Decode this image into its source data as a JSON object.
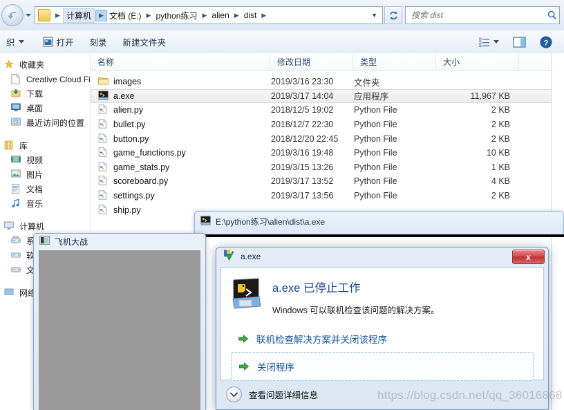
{
  "explorer": {
    "breadcrumb": {
      "root_label": "计算机",
      "items": [
        "文档 (E:)",
        "python练习",
        "alien",
        "dist"
      ]
    },
    "search": {
      "placeholder": "搜索 dist",
      "value": ""
    },
    "toolbar": {
      "organize_label": "织",
      "open_label": "打开",
      "burn_label": "刻录",
      "new_folder_label": "新建文件夹"
    },
    "nav_pane": {
      "groups": [
        {
          "header": "收藏夹",
          "icon": "star-icon",
          "items": [
            {
              "label": "Creative Cloud File",
              "icon": "file-icon"
            },
            {
              "label": "下载",
              "icon": "downloads-icon"
            },
            {
              "label": "桌面",
              "icon": "desktop-icon"
            },
            {
              "label": "最近访问的位置",
              "icon": "recent-places-icon"
            }
          ]
        },
        {
          "header": "库",
          "icon": "library-icon",
          "items": [
            {
              "label": "视频",
              "icon": "videos-icon"
            },
            {
              "label": "图片",
              "icon": "pictures-icon"
            },
            {
              "label": "文档",
              "icon": "documents-icon"
            },
            {
              "label": "音乐",
              "icon": "music-icon"
            }
          ]
        },
        {
          "header": "计算机",
          "icon": "computer-icon",
          "items": [
            {
              "label": "系统",
              "icon": "drive-icon"
            },
            {
              "label": "软件",
              "icon": "drive-icon"
            },
            {
              "label": "文档",
              "icon": "drive-icon"
            }
          ]
        },
        {
          "header": "网络",
          "icon": "network-icon",
          "items": []
        }
      ]
    },
    "columns": [
      "名称",
      "修改日期",
      "类型",
      "大小"
    ],
    "files": [
      {
        "name": "images",
        "date": "2019/3/16 23:30",
        "type": "文件夹",
        "size": "",
        "icon": "folder-icon",
        "selected": false
      },
      {
        "name": "a.exe",
        "date": "2019/3/17 14:04",
        "type": "应用程序",
        "size": "11,967 KB",
        "icon": "exe-icon",
        "selected": true
      },
      {
        "name": "alien.py",
        "date": "2018/12/5 19:02",
        "type": "Python File",
        "size": "2 KB",
        "icon": "python-icon",
        "selected": false
      },
      {
        "name": "bullet.py",
        "date": "2018/12/7 22:30",
        "type": "Python File",
        "size": "2 KB",
        "icon": "python-icon",
        "selected": false
      },
      {
        "name": "button.py",
        "date": "2018/12/20 22:45",
        "type": "Python File",
        "size": "2 KB",
        "icon": "python-icon",
        "selected": false
      },
      {
        "name": "game_functions.py",
        "date": "2019/3/16 19:48",
        "type": "Python File",
        "size": "10 KB",
        "icon": "python-icon",
        "selected": false
      },
      {
        "name": "game_stats.py",
        "date": "2019/3/15 13:26",
        "type": "Python File",
        "size": "1 KB",
        "icon": "python-icon",
        "selected": false
      },
      {
        "name": "scoreboard.py",
        "date": "2019/3/17 13:52",
        "type": "Python File",
        "size": "4 KB",
        "icon": "python-icon",
        "selected": false
      },
      {
        "name": "settings.py",
        "date": "2019/3/17 13:56",
        "type": "Python File",
        "size": "2 KB",
        "icon": "python-icon",
        "selected": false
      },
      {
        "name": "ship.py",
        "date": "",
        "type": "",
        "size": "",
        "icon": "python-icon",
        "selected": false
      }
    ]
  },
  "console_window": {
    "title": "E:\\python练习\\alien\\dist\\a.exe",
    "icon": "exe-icon"
  },
  "game_window": {
    "title": "飞机大战",
    "icon": "app-window-icon",
    "canvas_color": "#999999"
  },
  "error_dialog": {
    "titlebar_text": "a.exe",
    "titlebar_icon": "error-shield-icon",
    "close_label": "x",
    "heading": "a.exe 已停止工作",
    "subtext": "Windows 可以联机检查该问题的解决方案。",
    "actions": [
      {
        "label": "联机检查解决方案并关闭该程序",
        "focused": false
      },
      {
        "label": "关闭程序",
        "focused": true
      }
    ],
    "footer_label": "查看问题详细信息"
  },
  "watermark": {
    "text": "https://blog.csdn.net/qq_36016868"
  },
  "colors": {
    "accent_blue": "#18539e",
    "heading_blue": "#16428f",
    "close_red": "#c03030",
    "canvas_gray": "#999999"
  }
}
